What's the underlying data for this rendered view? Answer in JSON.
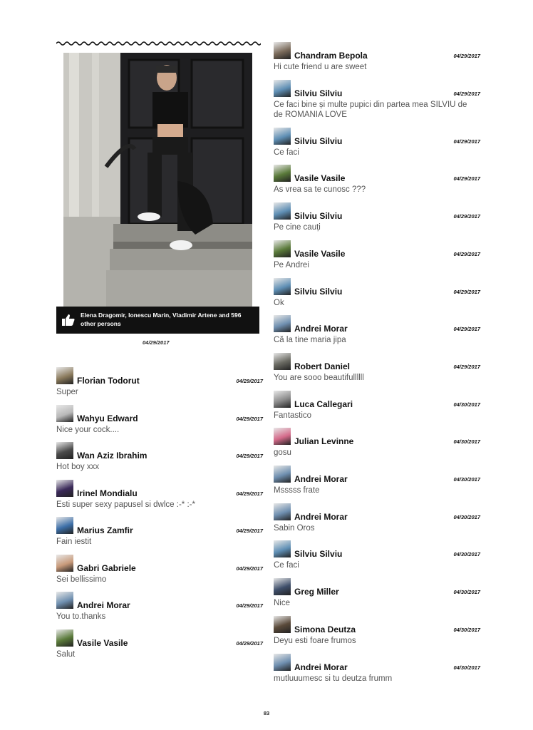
{
  "post": {
    "likes_text": "Elena Dragomir, Ionescu Marin, Vladimir Artene and 596 other persons",
    "date": "04/29/2017"
  },
  "left_comments": [
    {
      "name": "Florian Todorut",
      "date": "04/29/2017",
      "text": "Super",
      "avatar_color": "#8a7a5c"
    },
    {
      "name": "Wahyu Edward",
      "date": "04/29/2017",
      "text": "Nice your cock....",
      "avatar_color": "#b9b9b9"
    },
    {
      "name": "Wan Aziz Ibrahim",
      "date": "04/29/2017",
      "text": "Hot boy xxx",
      "avatar_color": "#4a4a4a"
    },
    {
      "name": "Irinel Mondialu",
      "date": "04/29/2017",
      "text": "Esti super sexy papusel si dwlce :-* :-*",
      "avatar_color": "#3b2a5a"
    },
    {
      "name": "Marius Zamfir",
      "date": "04/29/2017",
      "text": "Fain iestit",
      "avatar_color": "#3d6fa8"
    },
    {
      "name": "Gabri Gabriele",
      "date": "04/29/2017",
      "text": "Sei bellissimo",
      "avatar_color": "#c89a7a"
    },
    {
      "name": "Andrei Morar",
      "date": "04/29/2017",
      "text": "You to.thanks",
      "avatar_color": "#6f8fb0"
    },
    {
      "name": "Vasile Vasile",
      "date": "04/29/2017",
      "text": "Salut",
      "avatar_color": "#5a7a3a"
    }
  ],
  "right_comments": [
    {
      "name": "Chandram Bepola",
      "date": "04/29/2017",
      "text": "Hi cute friend u are sweet",
      "avatar_color": "#7a6a5a"
    },
    {
      "name": "Silviu Silviu",
      "date": "04/29/2017",
      "text": "Ce faci bine și multe pupici din partea mea SILVIU de de ROMANIA LOVE",
      "avatar_color": "#5f8fb5"
    },
    {
      "name": "Silviu Silviu",
      "date": "04/29/2017",
      "text": "Ce faci",
      "avatar_color": "#5f8fb5"
    },
    {
      "name": "Vasile Vasile",
      "date": "04/29/2017",
      "text": "As vrea sa te cunosc ???",
      "avatar_color": "#5a7a3a"
    },
    {
      "name": "Silviu Silviu",
      "date": "04/29/2017",
      "text": "Pe cine cauți",
      "avatar_color": "#5f8fb5"
    },
    {
      "name": "Vasile Vasile",
      "date": "04/29/2017",
      "text": "Pe Andrei",
      "avatar_color": "#5a7a3a"
    },
    {
      "name": "Silviu Silviu",
      "date": "04/29/2017",
      "text": "Ok",
      "avatar_color": "#5f8fb5"
    },
    {
      "name": "Andrei Morar",
      "date": "04/29/2017",
      "text": "Că la tine maria jipa",
      "avatar_color": "#6f8fb0"
    },
    {
      "name": "Robert Daniel",
      "date": "04/29/2017",
      "text": "You are sooo beautifullllll",
      "avatar_color": "#6a6a62"
    },
    {
      "name": "Luca Callegari",
      "date": "04/30/2017",
      "text": "Fantastico",
      "avatar_color": "#8a8a8a"
    },
    {
      "name": "Julian Levinne",
      "date": "04/30/2017",
      "text": "gosu",
      "avatar_color": "#d46a8a"
    },
    {
      "name": "Andrei Morar",
      "date": "04/30/2017",
      "text": "Msssss frate",
      "avatar_color": "#6f8fb0"
    },
    {
      "name": "Andrei Morar",
      "date": "04/30/2017",
      "text": "Sabin Oros",
      "avatar_color": "#6f8fb0"
    },
    {
      "name": "Silviu Silviu",
      "date": "04/30/2017",
      "text": "Ce faci",
      "avatar_color": "#5f8fb5"
    },
    {
      "name": "Greg Miller",
      "date": "04/30/2017",
      "text": "Nice",
      "avatar_color": "#3f4f6a"
    },
    {
      "name": "Simona Deutza",
      "date": "04/30/2017",
      "text": "Deyu esti foare frumos",
      "avatar_color": "#5a4a3a"
    },
    {
      "name": "Andrei Morar",
      "date": "04/30/2017",
      "text": "mutluuumesc si tu deutza frumm",
      "avatar_color": "#6f8fb0"
    }
  ],
  "page_number": "83"
}
